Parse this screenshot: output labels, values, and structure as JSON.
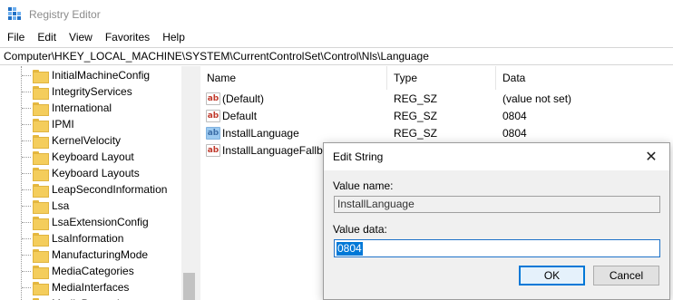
{
  "window": {
    "title": "Registry Editor"
  },
  "menu": [
    "File",
    "Edit",
    "View",
    "Favorites",
    "Help"
  ],
  "address": "Computer\\HKEY_LOCAL_MACHINE\\SYSTEM\\CurrentControlSet\\Control\\Nls\\Language",
  "tree": {
    "items": [
      {
        "label": "InitialMachineConfig",
        "expandable": false
      },
      {
        "label": "IntegrityServices",
        "expandable": false
      },
      {
        "label": "International",
        "expandable": true
      },
      {
        "label": "IPMI",
        "expandable": false
      },
      {
        "label": "KernelVelocity",
        "expandable": false
      },
      {
        "label": "Keyboard Layout",
        "expandable": true
      },
      {
        "label": "Keyboard Layouts",
        "expandable": true
      },
      {
        "label": "LeapSecondInformation",
        "expandable": false
      },
      {
        "label": "Lsa",
        "expandable": true
      },
      {
        "label": "LsaExtensionConfig",
        "expandable": true
      },
      {
        "label": "LsaInformation",
        "expandable": false
      },
      {
        "label": "ManufacturingMode",
        "expandable": true
      },
      {
        "label": "MediaCategories",
        "expandable": true
      },
      {
        "label": "MediaInterfaces",
        "expandable": true
      },
      {
        "label": "MediaProperties",
        "expandable": true
      }
    ]
  },
  "list": {
    "headers": {
      "name": "Name",
      "type": "Type",
      "data": "Data"
    },
    "rows": [
      {
        "name": "(Default)",
        "type": "REG_SZ",
        "data": "(value not set)",
        "icon": "string-value-icon",
        "selected": false
      },
      {
        "name": "Default",
        "type": "REG_SZ",
        "data": "0804",
        "icon": "string-value-icon",
        "selected": false
      },
      {
        "name": "InstallLanguage",
        "type": "REG_SZ",
        "data": "0804",
        "icon": "string-value-icon",
        "selected": true
      },
      {
        "name": "InstallLanguageFallback",
        "type": "",
        "data": "",
        "icon": "string-value-icon",
        "selected": false
      }
    ]
  },
  "dialog": {
    "title": "Edit String",
    "value_name_label": "Value name:",
    "value_name": "InstallLanguage",
    "value_data_label": "Value data:",
    "value_data": "0804",
    "ok_label": "OK",
    "cancel_label": "Cancel",
    "close_glyph": "✕"
  },
  "colors": {
    "accent": "#0078d7",
    "folder": "#f4cd5c"
  }
}
